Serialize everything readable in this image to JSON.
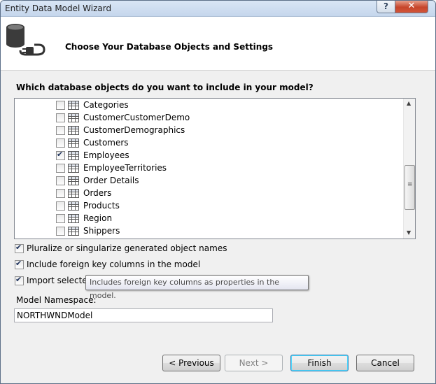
{
  "window": {
    "title": "Entity Data Model Wizard",
    "help_glyph": "?",
    "close_glyph": "✕"
  },
  "header": {
    "title": "Choose Your Database Objects and Settings"
  },
  "question": "Which database objects do you want to include in your model?",
  "objects": [
    {
      "label": "Categories",
      "checked": false
    },
    {
      "label": "CustomerCustomerDemo",
      "checked": false
    },
    {
      "label": "CustomerDemographics",
      "checked": false
    },
    {
      "label": "Customers",
      "checked": false
    },
    {
      "label": "Employees",
      "checked": true
    },
    {
      "label": "EmployeeTerritories",
      "checked": false
    },
    {
      "label": "Order Details",
      "checked": false
    },
    {
      "label": "Orders",
      "checked": false
    },
    {
      "label": "Products",
      "checked": false
    },
    {
      "label": "Region",
      "checked": false
    },
    {
      "label": "Shippers",
      "checked": false
    }
  ],
  "options": {
    "pluralize": {
      "label": "Pluralize or singularize generated object names",
      "checked": true
    },
    "foreign_keys": {
      "label": "Include foreign key columns in the model",
      "checked": true
    },
    "import_selected": {
      "label": "Import selected",
      "checked": true
    }
  },
  "tooltip": "Includes foreign key columns as properties in the model.",
  "namespace": {
    "label": "Model Namespace:",
    "value": "NORTHWNDModel"
  },
  "buttons": {
    "previous": "< Previous",
    "next": "Next >",
    "finish": "Finish",
    "cancel": "Cancel"
  },
  "icons": {
    "window": "help-icon, close-icon",
    "header": "database-plug-icon",
    "list": "table-icon"
  }
}
